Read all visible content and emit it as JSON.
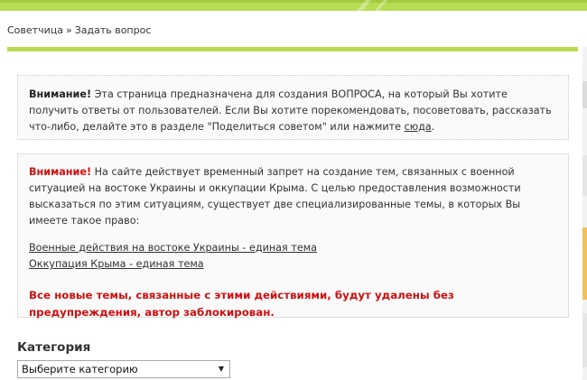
{
  "breadcrumb": {
    "home": "Советчица",
    "separator": "»",
    "current": "Задать вопрос"
  },
  "notice1": {
    "label": "Внимание!",
    "text_before_link": " Эта страница предназначена для создания ВОПРОСА, на который Вы хотите получить ответы от пользователей. Если Вы хотите порекомендовать, посоветовать, рассказать что-либо, делайте это в разделе \"Поделиться советом\" или нажмите ",
    "link": "сюда",
    "text_after_link": "."
  },
  "notice2": {
    "label": "Внимание!",
    "text": " На сайте действует временный запрет на создание тем, связанных с военной ситуацией на востоке Украины и оккупации Крыма. С целью предоставления возможности высказаться по этим ситуациям, существует две специализированные темы, в которых Вы имеете такое право:",
    "links": [
      "Военные действия на востоке Украины - единая тема",
      "Оккупация Крыма - единая тема"
    ],
    "final": "Все новые темы, связанные с этими действиями, будут удалены без предупреждения, автор заблокирован."
  },
  "category": {
    "label": "Категория",
    "selected": "Выберите категорию"
  },
  "colors": {
    "accent_green": "#b7dd55",
    "warning_red": "#cc1010"
  }
}
